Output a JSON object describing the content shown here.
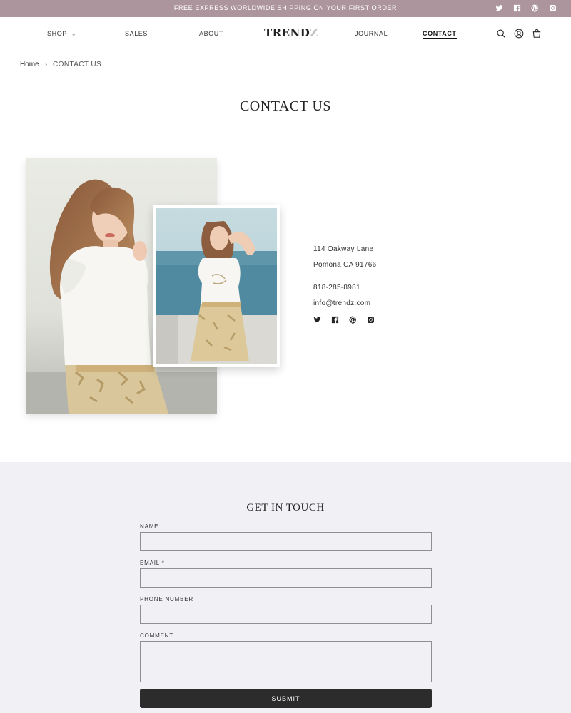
{
  "announcement": {
    "text": "FREE EXPRESS WORLDWIDE SHIPPING ON YOUR FIRST ORDER",
    "background": "#ad959d",
    "social_icons": [
      "twitter-icon",
      "facebook-icon",
      "pinterest-icon",
      "instagram-icon"
    ]
  },
  "header": {
    "nav_left": [
      {
        "label": "SHOP",
        "has_dropdown": true
      },
      {
        "label": "SALES"
      },
      {
        "label": "ABOUT"
      }
    ],
    "logo": {
      "main": "TREND",
      "accent": "Z"
    },
    "nav_right": [
      {
        "label": "JOURNAL"
      },
      {
        "label": "CONTACT",
        "active": true
      }
    ],
    "icons": [
      "search-icon",
      "account-icon",
      "cart-icon"
    ]
  },
  "breadcrumb": {
    "home": "Home",
    "current": "CONTACT US"
  },
  "page_title": "CONTACT US",
  "contact": {
    "address_line1": "114 Oakway Lane",
    "address_line2": "Pomona CA 91766",
    "phone": "818-285-8981",
    "email": "info@trendz.com",
    "social_icons": [
      "twitter-icon",
      "facebook-icon",
      "pinterest-icon",
      "instagram-icon"
    ]
  },
  "form": {
    "title": "GET IN TOUCH",
    "name_label": "NAME",
    "name_value": "",
    "email_label": "EMAIL *",
    "email_value": "",
    "phone_label": "PHONE NUMBER",
    "phone_value": "",
    "comment_label": "COMMENT",
    "comment_value": "",
    "submit_label": "SUBMIT",
    "background": "#f1f0f4",
    "button_color": "#2c2c2c"
  }
}
